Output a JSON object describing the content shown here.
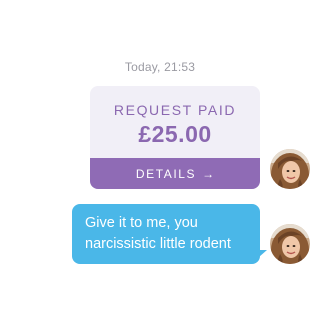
{
  "chat": {
    "timestamp": "Today, 21:53",
    "request_card": {
      "label": "REQUEST PAID",
      "amount": "£25.00",
      "details_label": "DETAILS",
      "details_arrow": "→"
    },
    "message": {
      "line1": "Give it to me, you",
      "line2": "narcissistic little rodent"
    }
  },
  "icons": {
    "details_arrow": "arrow-right-icon",
    "avatar": "user-avatar"
  },
  "colors": {
    "request_card_bg": "#f1eff7",
    "request_accent": "#8b68b0",
    "details_button": "#8f6bb5",
    "message_bubble": "#4ab7e8",
    "timestamp": "#9a9aa2"
  }
}
